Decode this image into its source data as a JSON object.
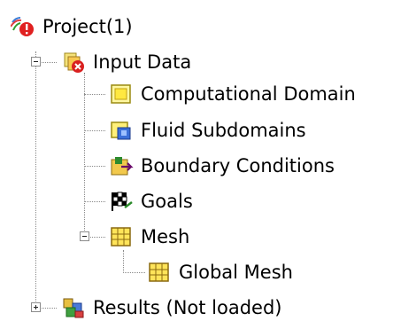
{
  "tree": {
    "root": {
      "label": "Project(1)",
      "icon": "project-icon"
    },
    "input_data": {
      "label": "Input Data",
      "icon": "input-data-icon"
    },
    "computational_domain": {
      "label": "Computational Domain",
      "icon": "computational-domain-icon"
    },
    "fluid_subdomains": {
      "label": "Fluid Subdomains",
      "icon": "fluid-subdomains-icon"
    },
    "boundary_conditions": {
      "label": "Boundary Conditions",
      "icon": "boundary-conditions-icon"
    },
    "goals": {
      "label": "Goals",
      "icon": "goals-icon"
    },
    "mesh": {
      "label": "Mesh",
      "icon": "mesh-icon"
    },
    "global_mesh": {
      "label": "Global Mesh",
      "icon": "global-mesh-icon"
    },
    "results": {
      "label": "Results (Not loaded)",
      "icon": "results-icon"
    }
  }
}
